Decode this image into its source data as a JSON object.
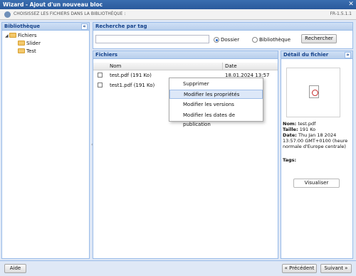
{
  "window": {
    "title": "Wizard - Ajout d'un nouveau bloc",
    "close_icon": "close-icon"
  },
  "stepbar": {
    "text": "Choisissez les fichiers dans la bibliothèque :",
    "version": "FR-1.5.1.1"
  },
  "library": {
    "title": "Bibliothèque",
    "collapse": "«",
    "tree": [
      {
        "label": "Fichiers",
        "expanded": true
      },
      {
        "label": "Slider"
      },
      {
        "label": "Test"
      }
    ]
  },
  "search": {
    "title": "Recherche par tag",
    "input_value": "",
    "options": [
      {
        "label": "Dossier",
        "checked": true
      },
      {
        "label": "Bibliothèque",
        "checked": false
      }
    ],
    "button": "Rechercher"
  },
  "files": {
    "title": "Fichiers",
    "columns": {
      "name": "Nom",
      "date": "Date"
    },
    "rows": [
      {
        "name": "test.pdf (191 Ko)",
        "date": "18.01.2024 13:57"
      },
      {
        "name": "test1.pdf (191 Ko)",
        "date": ""
      }
    ]
  },
  "context_menu": {
    "items": [
      {
        "label": "Supprimer",
        "active": false
      },
      {
        "label": "Modifier les propriétés",
        "active": true
      },
      {
        "label": "Modifier les versions",
        "active": false
      },
      {
        "label": "Modifier les dates de publication",
        "active": false
      }
    ]
  },
  "detail": {
    "title": "Détail du fichier",
    "collapse": "»",
    "name_label": "Nom:",
    "name_value": "test.pdf",
    "size_label": "Taille:",
    "size_value": "191 Ko",
    "date_label": "Date:",
    "date_value": "Thu Jan 18 2024",
    "date_value_2": "13:57:00 GMT+0100 (heure",
    "date_value_3": "normale d'Europe centrale)",
    "tags_label": "Tags:",
    "view_button": "Visualiser"
  },
  "footer": {
    "help": "Aide",
    "previous": "« Précédent",
    "next": "Suivant »"
  }
}
